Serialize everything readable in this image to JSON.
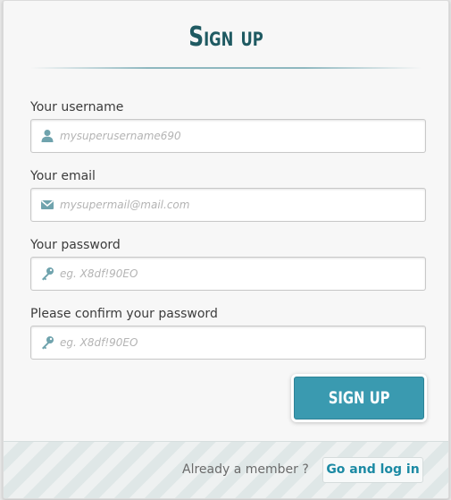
{
  "form": {
    "title": "Sign up",
    "submit_label": "SIGN UP"
  },
  "fields": {
    "username": {
      "label": "Your username",
      "placeholder": "mysuperusername690",
      "icon": "user-icon"
    },
    "email": {
      "label": "Your email",
      "placeholder": "mysupermail@mail.com",
      "icon": "envelope-icon"
    },
    "password": {
      "label": "Your password",
      "placeholder": "eg. X8df!90EO",
      "icon": "key-icon"
    },
    "confirm_password": {
      "label": "Please confirm your password",
      "placeholder": "eg. X8df!90EO",
      "icon": "key-icon"
    }
  },
  "footer": {
    "prompt": "Already a member ?",
    "login_label": "Go and log in"
  },
  "colors": {
    "accent": "#3a9ab0",
    "title": "#1f5a62",
    "icon": "#6fa3ad",
    "link": "#1c8aa4"
  }
}
